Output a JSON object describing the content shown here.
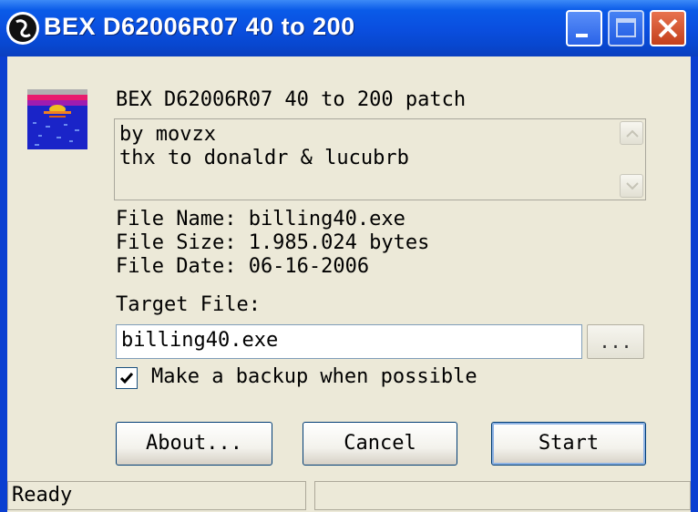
{
  "window": {
    "title": "BEX D62006R07 40 to 200",
    "icon": "app-icon",
    "controls": [
      "minimize-icon",
      "maximize-icon",
      "close-icon"
    ]
  },
  "patch": {
    "title": "BEX D62006R07 40 to 200 patch",
    "memo_lines": [
      "by movzx",
      "thx to donaldr & lucubrb"
    ]
  },
  "file_info": {
    "name_label": "File Name: billing40.exe",
    "size_label": "File Size: 1.985.024 bytes",
    "date_label": "File Date: 06-16-2006"
  },
  "target": {
    "label": "Target File:",
    "value": "billing40.exe",
    "browse_label": "..."
  },
  "backup": {
    "checked": true,
    "label": "Make a backup when possible"
  },
  "buttons": {
    "about": "About...",
    "cancel": "Cancel",
    "start": "Start"
  },
  "status": {
    "text": "Ready",
    "text2": ""
  },
  "colors": {
    "titlebar": "#0a4fe0",
    "face": "#ece9d8",
    "close": "#c4401c"
  }
}
